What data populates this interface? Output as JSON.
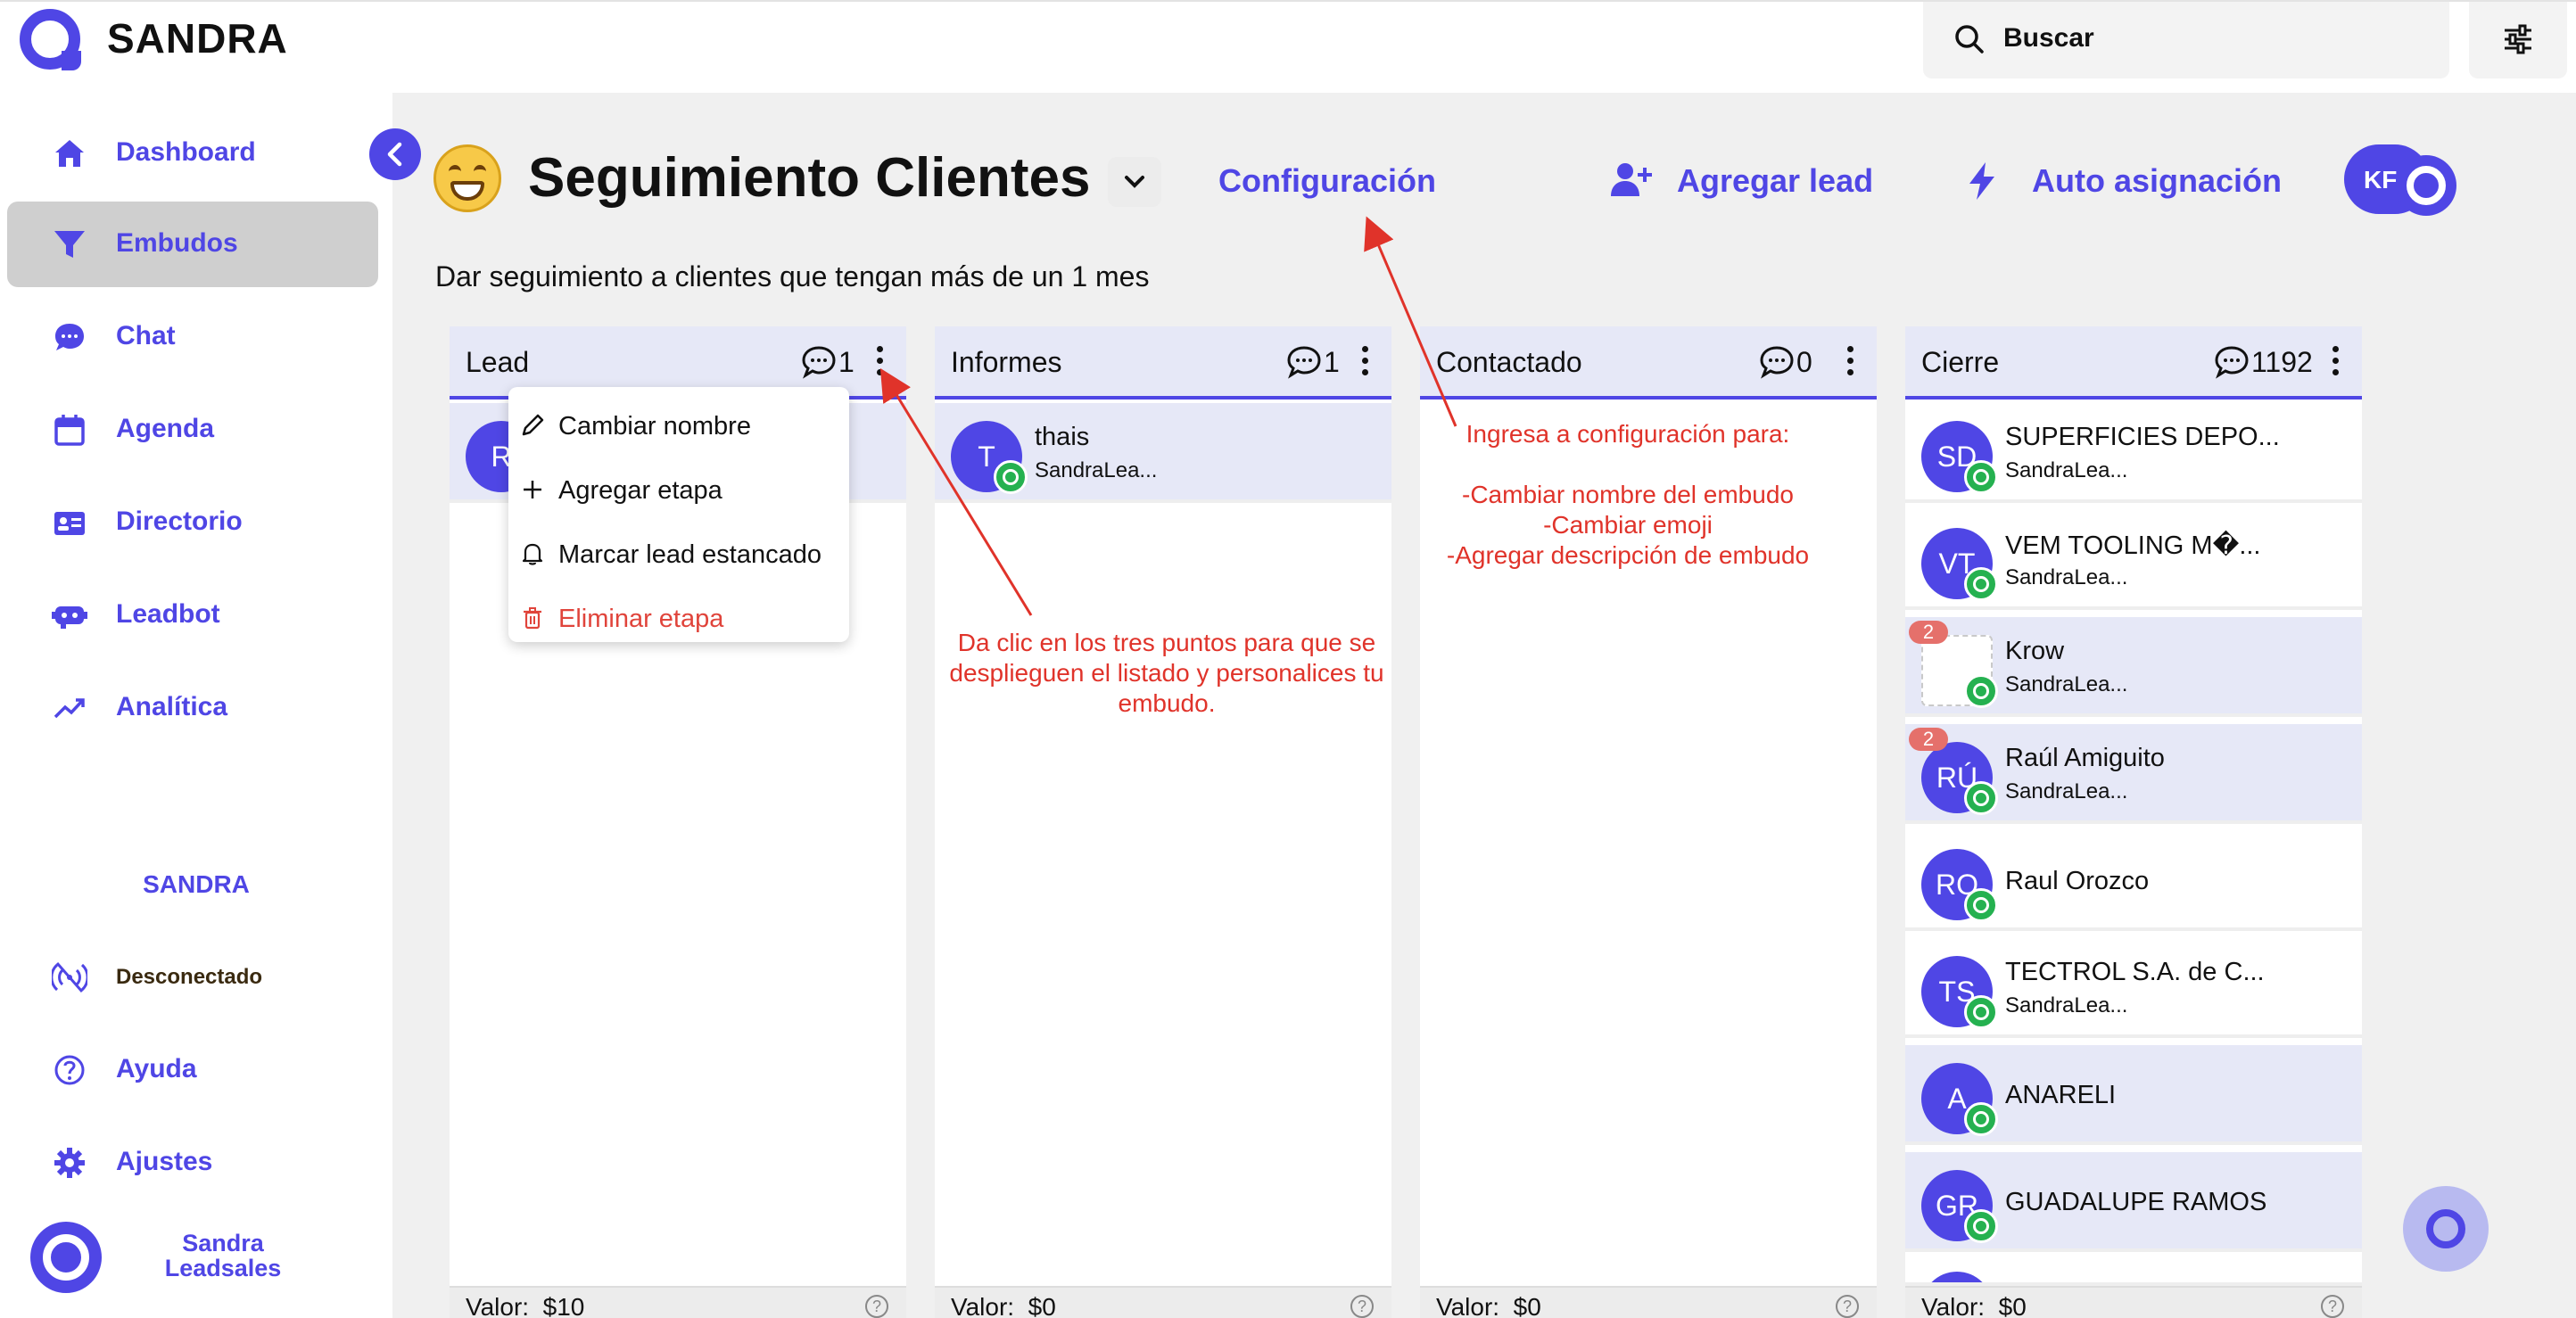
{
  "app": {
    "brand": "SANDRA"
  },
  "search": {
    "placeholder": "Buscar"
  },
  "sidebar": {
    "items": [
      {
        "label": "Dashboard",
        "icon": "home-icon"
      },
      {
        "label": "Embudos",
        "icon": "funnel-icon",
        "active": true
      },
      {
        "label": "Chat",
        "icon": "chat-icon"
      },
      {
        "label": "Agenda",
        "icon": "calendar-icon"
      },
      {
        "label": "Directorio",
        "icon": "contact-card-icon"
      },
      {
        "label": "Leadbot",
        "icon": "bot-icon"
      },
      {
        "label": "Analítica",
        "icon": "trend-icon"
      }
    ],
    "section_label": "SANDRA",
    "connection_status": "Desconectado",
    "help_label": "Ayuda",
    "settings_label": "Ajustes",
    "user_name_line1": "Sandra",
    "user_name_line2": "Leadsales"
  },
  "header": {
    "title": "Seguimiento Clientes",
    "config_link": "Configuración",
    "add_lead_label": "Agregar lead",
    "auto_assign_label": "Auto asignación",
    "avatar_initials": "KF",
    "description": "Dar seguimiento a clientes que tengan más de un 1 mes"
  },
  "columns": [
    {
      "name": "Lead",
      "count": "1",
      "footer_label": "Valor:",
      "footer_value": "$10",
      "cards": [
        {
          "initials": "R"
        }
      ]
    },
    {
      "name": "Informes",
      "count": "1",
      "footer_label": "Valor:",
      "footer_value": "$0",
      "cards": [
        {
          "initials": "T",
          "name": "thais",
          "sub": "SandraLea..."
        }
      ]
    },
    {
      "name": "Contactado",
      "count": "0",
      "footer_label": "Valor:",
      "footer_value": "$0",
      "cards": []
    },
    {
      "name": "Cierre",
      "count": "1192",
      "footer_label": "Valor:",
      "footer_value": "$0",
      "cards": [
        {
          "initials": "SD",
          "name": "SUPERFICIES DEPO...",
          "sub": "SandraLea..."
        },
        {
          "initials": "VT",
          "name": "VEM TOOLING M�...",
          "sub": "SandraLea..."
        },
        {
          "initials": "",
          "name": "Krow",
          "sub": "SandraLea...",
          "badge": "2"
        },
        {
          "initials": "RÚ",
          "name": "Raúl Amiguito",
          "sub": "SandraLea...",
          "badge": "2"
        },
        {
          "initials": "RO",
          "name": "Raul Orozco"
        },
        {
          "initials": "TS",
          "name": "TECTROL S.A. de C...",
          "sub": "SandraLea..."
        },
        {
          "initials": "A",
          "name": "ANARELI"
        },
        {
          "initials": "GR",
          "name": "GUADALUPE RAMOS"
        }
      ]
    }
  ],
  "stage_menu": {
    "items": [
      {
        "label": "Cambiar nombre",
        "icon": "pencil-icon"
      },
      {
        "label": "Agregar etapa",
        "icon": "plus-icon"
      },
      {
        "label": "Marcar lead estancado",
        "icon": "bell-icon"
      },
      {
        "label": "Eliminar etapa",
        "icon": "trash-icon"
      }
    ]
  },
  "annotations": {
    "dots_hint": "Da clic en los tres puntos para que se desplieguen el listado y personalices tu embudo.",
    "config_hint_title": "Ingresa a configuración para:",
    "config_hint_1": "-Cambiar nombre del embudo",
    "config_hint_2": "-Cambiar emoji",
    "config_hint_3": "-Agregar descripción de embudo"
  },
  "colors": {
    "accent": "#4f46e5",
    "danger": "#e0443b",
    "annotation": "#e0332a",
    "whatsapp": "#25b150"
  }
}
